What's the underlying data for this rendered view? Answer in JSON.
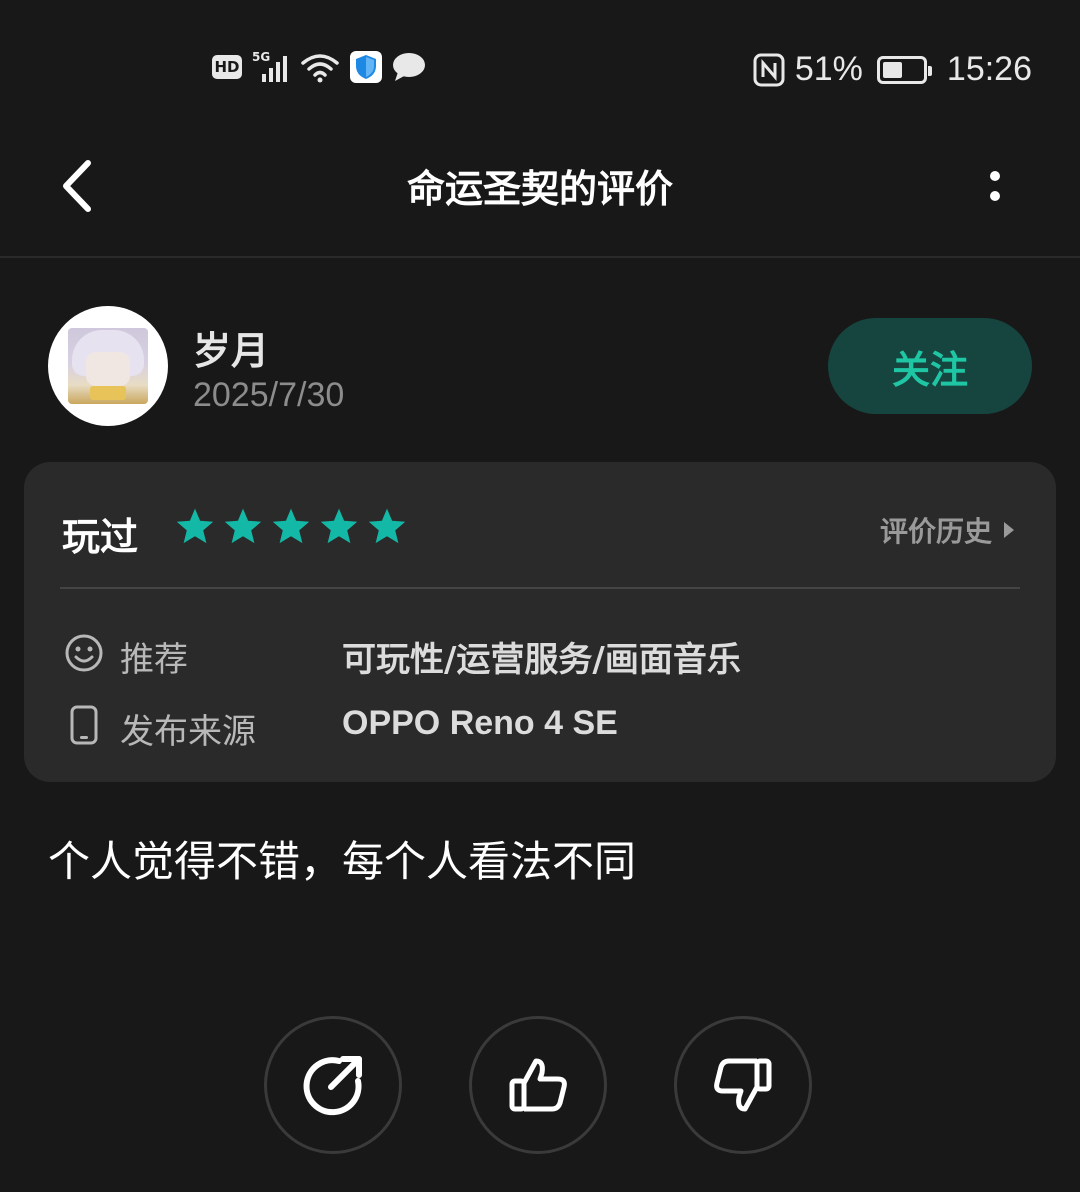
{
  "status_bar": {
    "hd_label": "HD",
    "network_label": "5G",
    "battery_text": "51%",
    "battery_level": 0.51,
    "time": "15:26",
    "icons": [
      "hd-icon",
      "signal-5g-icon",
      "wifi-icon",
      "security-shield-icon",
      "message-bubble-icon",
      "nfc-icon",
      "battery-icon"
    ]
  },
  "header": {
    "title": "命运圣契的评价",
    "back_icon": "back-arrow-icon",
    "more_icon": "more-vertical-icon"
  },
  "author": {
    "name": "岁月",
    "date": "2025/7/30",
    "follow_label": "关注"
  },
  "rating_card": {
    "played_label": "玩过",
    "stars": 5,
    "max_stars": 5,
    "history_label": "评价历史",
    "rows": [
      {
        "icon": "smiley-icon",
        "label": "推荐",
        "value": "可玩性/运营服务/画面音乐"
      },
      {
        "icon": "phone-icon",
        "label": "发布来源",
        "value": "OPPO Reno 4 SE"
      }
    ]
  },
  "review": {
    "text": "个人觉得不错，每个人看法不同"
  },
  "actions": [
    {
      "icon": "share-icon"
    },
    {
      "icon": "thumbs-up-icon"
    },
    {
      "icon": "thumbs-down-icon"
    }
  ],
  "colors": {
    "background": "#181818",
    "card": "#2a2a2a",
    "accent": "#1ec6a4",
    "follow_bg": "#16443f",
    "star": "#14b8a6"
  }
}
